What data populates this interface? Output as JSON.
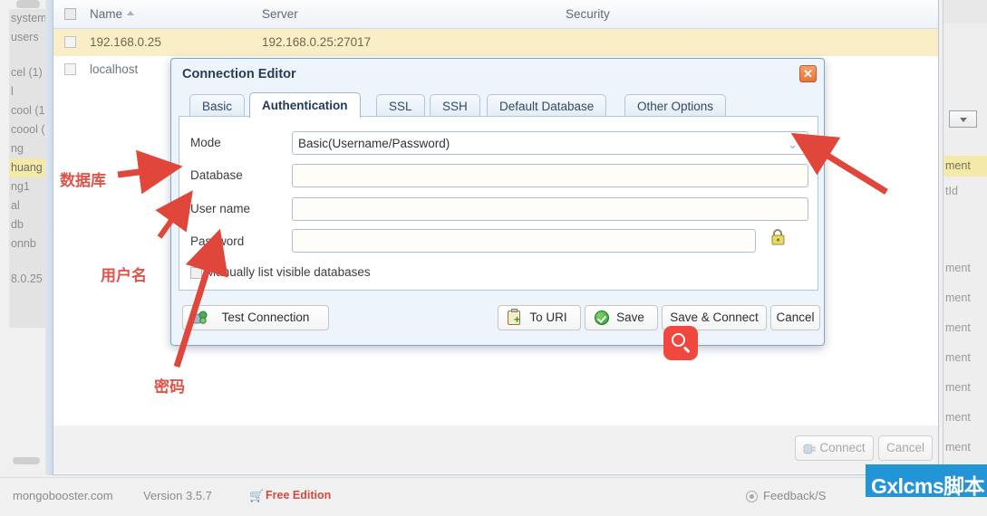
{
  "connection_manager": {
    "columns": [
      "Name",
      "Server",
      "Security"
    ],
    "sort_indicator": "▲",
    "rows": [
      {
        "name": "192.168.0.25",
        "server": "192.168.0.25:27017",
        "security": ""
      },
      {
        "name": "localhost",
        "server": "",
        "security": ""
      }
    ],
    "footer": {
      "connect_label": "Connect",
      "cancel_label": "Cancel"
    }
  },
  "left_tree": {
    "items": [
      "system",
      "users",
      "cel (1)",
      "l",
      "cool (1",
      "coool (",
      "ng",
      "huang",
      "ng1",
      "al",
      "db",
      "onnb",
      "8.0.25"
    ],
    "selected": "huang"
  },
  "right_panel": {
    "items": [
      "ment",
      "tId",
      "",
      "ment",
      "ment",
      "ment",
      "ment",
      "ment",
      "ment"
    ],
    "highlighted": "ment"
  },
  "dialog": {
    "title": "Connection Editor",
    "close_label": "✕",
    "tabs": [
      {
        "label": "Basic",
        "active": false
      },
      {
        "label": "Authentication",
        "active": true
      },
      {
        "label": "SSL",
        "active": false
      },
      {
        "label": "SSH",
        "active": false
      },
      {
        "label": "Default Database",
        "active": false
      },
      {
        "label": "Other Options",
        "active": false
      }
    ],
    "fields": {
      "mode": {
        "label": "Mode",
        "value": "Basic(Username/Password)",
        "options": [
          "Basic(Username/Password)"
        ]
      },
      "database": {
        "label": "Database",
        "value": "",
        "placeholder": ""
      },
      "username": {
        "label": "User name",
        "value": "",
        "placeholder": ""
      },
      "password": {
        "label": "Password",
        "value": "",
        "placeholder": ""
      }
    },
    "checkbox": {
      "label": "Manually list visible databases",
      "checked": false
    },
    "buttons": {
      "test_connection": "Test Connection",
      "to_uri": "To URI",
      "save": "Save",
      "save_and_connect": "Save & Connect",
      "cancel": "Cancel"
    }
  },
  "annotations": {
    "database": "数据库",
    "username": "用户名",
    "password": "密码",
    "color": "#e0534a"
  },
  "statusbar": {
    "site": "mongobooster.com",
    "version": "Version 3.5.7",
    "edition": "Free Edition",
    "cart_icon": "cart-icon",
    "feedback": "Feedback/S"
  },
  "watermark": {
    "text": "Gxlcms脚本",
    "bg": "#2394d6"
  }
}
